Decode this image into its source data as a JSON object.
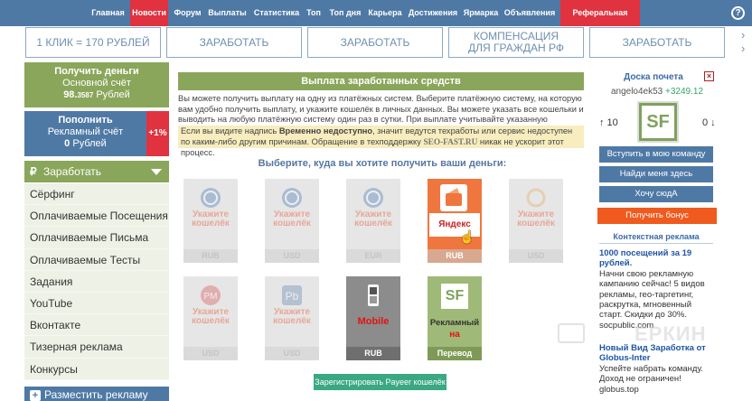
{
  "nav": {
    "items": [
      "Главная",
      "Новости",
      "Форум",
      "Выплаты",
      "Статистика",
      "Топ",
      "Топ дня",
      "Карьера",
      "Достижения",
      "Ярмарка",
      "Объявления",
      "Реферальная стена"
    ],
    "help": "?"
  },
  "banners": [
    "1 КЛИК = 170 РУБЛЕЙ",
    "ЗАРАБОТАТЬ",
    "ЗАРАБОТАТЬ",
    "КОМПЕНСАЦИЯ ДЛЯ ГРАЖДАН РФ",
    "ЗАРАБОТАТЬ"
  ],
  "left": {
    "get_money": {
      "title": "Получить деньги",
      "account": "Основной счёт",
      "amount_main": "98.",
      "amount_frac": "3587",
      "currency": "Рублей"
    },
    "topup": {
      "title": "Пополнить",
      "account": "Рекламный счёт",
      "amount": "0",
      "currency": "Рублей",
      "bonus": "+1%"
    },
    "earn_header": "Заработать",
    "earn_icon": "ruble-icon",
    "menu": [
      "Сёрфинг",
      "Оплачиваемые Посещения",
      "Оплачиваемые Письма",
      "Оплачиваемые Тесты",
      "Задания",
      "YouTube",
      "Вконтакте",
      "Тизерная реклама",
      "Конкурсы"
    ],
    "place_ad": "Разместить рекламу"
  },
  "main": {
    "title": "Выплата заработанных средств",
    "intro": "Вы можете получить выплату на одну из платёжных систем. Выберите платёжную систему, на которую вам удобно получить выплату, и укажите кошелёк в личных данных. Вы можете указать все кошельки и выводить на любую платёжную систему один раз в сутки. При выплате учитывайте указанную комиссию.",
    "notice_pre": "Если вы видите надпись ",
    "notice_bold": "Временно недоступно",
    "notice_mid": ", значит ведутся техработы или сервис недоступен по каким-либо другим причинам. Обращение в техподдержку ",
    "notice_site": "SEO-FAST.RU",
    "notice_post": " никак не ускорит этот процесс.",
    "choose": "Выберите, куда вы хотите получить ваши деньги:",
    "tiles_row1": [
      {
        "warn": "Укажите кошелёк",
        "cur": "RUB",
        "icon": "webmoney-icon"
      },
      {
        "warn": "Укажите кошелёк",
        "cur": "USD",
        "icon": "webmoney-icon"
      },
      {
        "warn": "Укажите кошелёк",
        "cur": "EUR",
        "icon": "webmoney-icon"
      },
      {
        "name": "Яндекс",
        "cur": "RUB",
        "icon": "yandex-money-icon"
      },
      {
        "warn": "Укажите кошелёк",
        "cur": "USD",
        "icon": "circle-icon"
      }
    ],
    "tiles_row2": [
      {
        "warn": "Укажите кошелёк",
        "cur": "USD",
        "icon": "perfect-money-icon"
      },
      {
        "warn": "Укажите кошелёк",
        "cur": "USD",
        "icon": "payeer-icon"
      },
      {
        "name": "Mobile",
        "cur": "RUB",
        "icon": "mobile-phone-icon"
      },
      {
        "name": "Рекламный",
        "name2": "на",
        "cur": "Перевод",
        "icon": "sf-logo-icon"
      }
    ],
    "register_payeer": "Зарегистрировать Payeer кошелёк"
  },
  "right": {
    "honor_title": "Доска почета",
    "honor_user": "angelo4ek53",
    "honor_plus": "+3249.12",
    "likes": "↑ 10",
    "dislikes": "0 ↓",
    "avatar_text": "SF",
    "buttons": [
      "Вступить в мою команду",
      "Найди меня здесь",
      "Хочу сюдА"
    ],
    "bonus": "Получить бонус",
    "ctx_title": "Контекстная реклама",
    "ads": [
      {
        "h": "1000 посещений за 19 рублей.",
        "d": "Начни свою рекламную кампанию сейчас! 5 видов рекламы, гео-таргетинг, раскрутка, мгновенный старт. Скидки до 30%.",
        "u": "socpublic.com"
      },
      {
        "h": "Новый Вид Заработка от Globus-Inter",
        "d": "Успейте набрать команду. Доход не ограничен!",
        "u": "globus.top"
      }
    ]
  },
  "watermark": "ЕРКИН",
  "colors": {
    "nav": "#4f79a5",
    "green": "#8aa65a",
    "red": "#e0323f",
    "orange": "#f05a1e",
    "teal": "#3aa883"
  }
}
